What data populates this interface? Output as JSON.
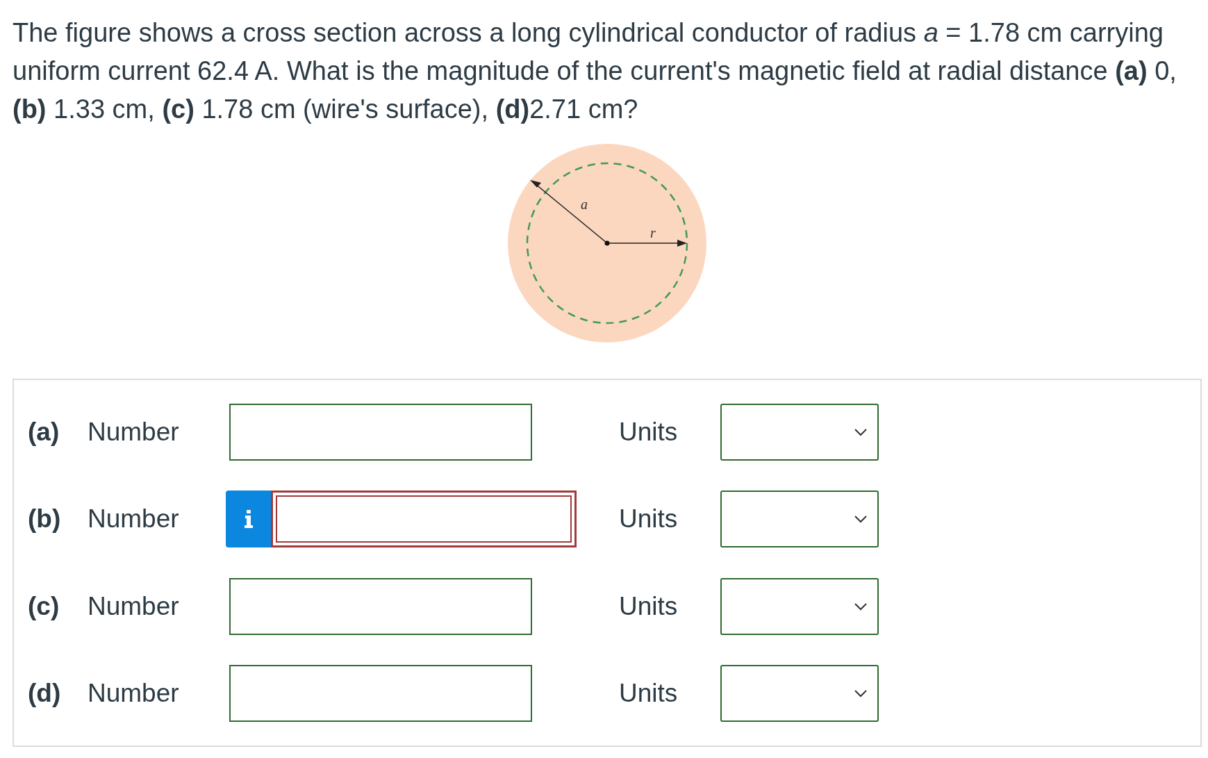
{
  "question": "The figure shows a cross section across a long cylindrical conductor of radius *a* = 1.78 cm carrying uniform current 62.4 A. What is the magnitude of the current's magnetic field at radial distance **(a)** 0, **(b)** 1.33 cm, **(c)** 1.78 cm (wire's surface), **(d)**2.71 cm?",
  "figure": {
    "labels": [
      {
        "kind": "radius",
        "text": "a"
      },
      {
        "kind": "distance",
        "text": "r"
      }
    ]
  },
  "parts": [
    {
      "label": "(a)",
      "field_label": "Number",
      "units_label": "Units",
      "info": false,
      "invalid": false
    },
    {
      "label": "(b)",
      "field_label": "Number",
      "units_label": "Units",
      "info": true,
      "invalid": true
    },
    {
      "label": "(c)",
      "field_label": "Number",
      "units_label": "Units",
      "info": false,
      "invalid": false
    },
    {
      "label": "(d)",
      "field_label": "Number",
      "units_label": "Units",
      "info": false,
      "invalid": false
    }
  ]
}
